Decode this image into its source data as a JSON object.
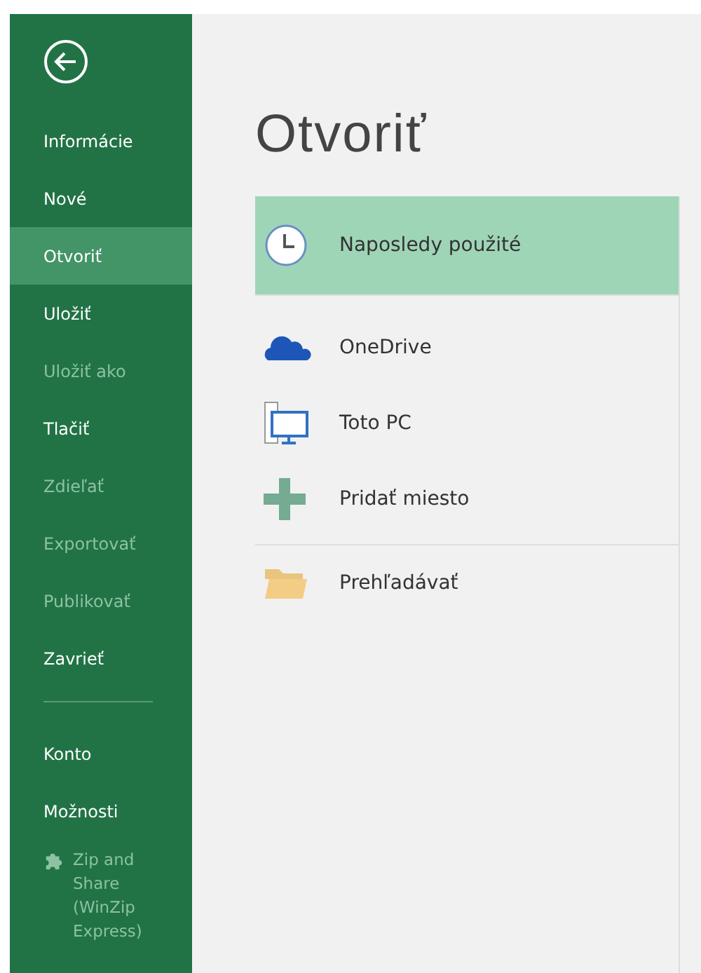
{
  "sidebar": {
    "items": [
      {
        "label": "Informácie",
        "selected": false,
        "disabled": false
      },
      {
        "label": "Nové",
        "selected": false,
        "disabled": false
      },
      {
        "label": "Otvoriť",
        "selected": true,
        "disabled": false
      },
      {
        "label": "Uložiť",
        "selected": false,
        "disabled": false
      },
      {
        "label": "Uložiť ako",
        "selected": false,
        "disabled": true
      },
      {
        "label": "Tlačiť",
        "selected": false,
        "disabled": false
      },
      {
        "label": "Zdieľať",
        "selected": false,
        "disabled": true
      },
      {
        "label": "Exportovať",
        "selected": false,
        "disabled": true
      },
      {
        "label": "Publikovať",
        "selected": false,
        "disabled": true
      },
      {
        "label": "Zavrieť",
        "selected": false,
        "disabled": false
      }
    ],
    "bottom_items": [
      {
        "label": "Konto",
        "selected": false,
        "disabled": false,
        "kind": "plain"
      },
      {
        "label": "Možnosti",
        "selected": false,
        "disabled": false,
        "kind": "plain"
      },
      {
        "label": "Zip and Share (WinZip Express)",
        "selected": false,
        "disabled": true,
        "kind": "addin"
      }
    ]
  },
  "title": "Otvoriť",
  "place_groups": [
    [
      {
        "label": "Naposledy použité",
        "kind": "clock",
        "selected": true
      }
    ],
    [
      {
        "label": "OneDrive",
        "kind": "cloud",
        "selected": false
      },
      {
        "label": "Toto PC",
        "kind": "pc",
        "selected": false
      },
      {
        "label": "Pridať miesto",
        "kind": "plus",
        "selected": false
      }
    ],
    [
      {
        "label": "Prehľadávať",
        "kind": "folder",
        "selected": false
      }
    ]
  ]
}
